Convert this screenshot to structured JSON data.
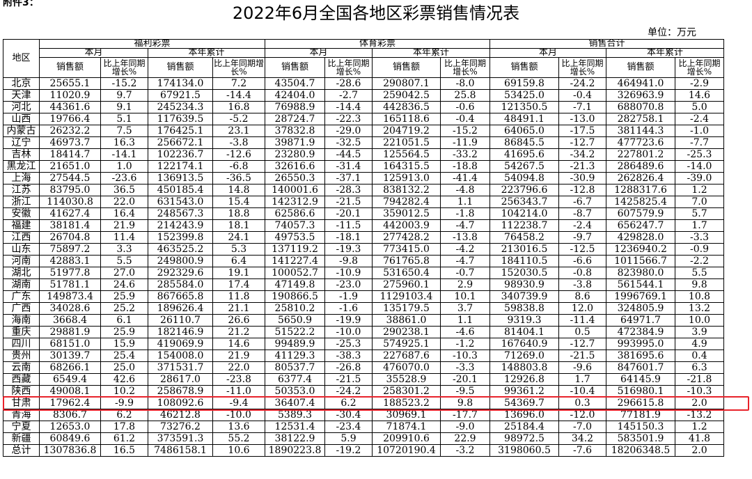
{
  "top_note": "附件3：",
  "title": "2022年6月全国各地区彩票销售情况表",
  "unit": "单位：万元",
  "headers": {
    "region": "地区",
    "groups": [
      "福利彩票",
      "体育彩票",
      "销售合计"
    ],
    "periods": [
      "本月",
      "本年累计"
    ],
    "sales": "销售额",
    "growth": "比上年同期增长%"
  },
  "rows": [
    {
      "region": "北京",
      "cells": [
        "25655.1",
        "-15.2",
        "174134.0",
        "7.2",
        "43504.7",
        "-28.6",
        "290807.1",
        "-8.0",
        "69159.8",
        "-24.2",
        "464941.0",
        "-2.9"
      ]
    },
    {
      "region": "天津",
      "cells": [
        "11020.9",
        "9.7",
        "67921.5",
        "-14.4",
        "42404.0",
        "-2.7",
        "259042.5",
        "25.8",
        "53425.0",
        "-0.4",
        "326963.9",
        "14.6"
      ]
    },
    {
      "region": "河北",
      "cells": [
        "44361.6",
        "9.1",
        "245234.3",
        "16.8",
        "76988.9",
        "-14.4",
        "442836.5",
        "-0.6",
        "121350.5",
        "-7.1",
        "688070.8",
        "5.0"
      ]
    },
    {
      "region": "山西",
      "cells": [
        "19766.4",
        "5.1",
        "117639.5",
        "-5.2",
        "28724.7",
        "-22.3",
        "165118.6",
        "-0.4",
        "48491.1",
        "-13.0",
        "282758.1",
        "-2.4"
      ]
    },
    {
      "region": "内蒙古",
      "cells": [
        "26232.2",
        "7.5",
        "176425.1",
        "23.1",
        "37832.8",
        "-29.0",
        "204719.2",
        "-15.2",
        "64065.0",
        "-17.5",
        "381144.3",
        "-1.0"
      ]
    },
    {
      "region": "辽宁",
      "cells": [
        "46973.7",
        "16.3",
        "256672.1",
        "-3.8",
        "39871.9",
        "-32.5",
        "221051.5",
        "-11.9",
        "86845.5",
        "-12.7",
        "477723.6",
        "-7.7"
      ]
    },
    {
      "region": "吉林",
      "cells": [
        "18414.7",
        "-14.1",
        "102236.7",
        "-12.6",
        "23280.9",
        "-44.5",
        "125564.5",
        "-33.2",
        "41695.6",
        "-34.2",
        "227801.2",
        "-25.3"
      ]
    },
    {
      "region": "黑龙江",
      "cells": [
        "21651.0",
        "1.0",
        "122174.1",
        "-6.8",
        "32616.6",
        "-31.4",
        "164315.5",
        "-18.8",
        "54267.5",
        "-21.3",
        "286489.6",
        "-14.0"
      ]
    },
    {
      "region": "上海",
      "cells": [
        "27544.5",
        "-23.6",
        "136913.5",
        "-36.5",
        "26550.3",
        "-37.1",
        "125913.0",
        "-41.4",
        "54094.8",
        "-30.9",
        "262826.4",
        "-39.0"
      ]
    },
    {
      "region": "江苏",
      "cells": [
        "83795.0",
        "36.5",
        "450185.4",
        "14.8",
        "140001.6",
        "-28.3",
        "838132.2",
        "-4.8",
        "223796.6",
        "-12.8",
        "1288317.6",
        "1.2"
      ]
    },
    {
      "region": "浙江",
      "cells": [
        "114030.8",
        "22.0",
        "631543.0",
        "15.4",
        "142312.9",
        "-21.5",
        "794282.4",
        "1.1",
        "256343.7",
        "-6.7",
        "1425825.4",
        "7.0"
      ]
    },
    {
      "region": "安徽",
      "cells": [
        "41627.4",
        "16.4",
        "248567.3",
        "18.8",
        "62586.6",
        "-20.1",
        "359012.5",
        "-1.8",
        "104214.0",
        "-8.7",
        "607579.9",
        "5.7"
      ]
    },
    {
      "region": "福建",
      "cells": [
        "38181.4",
        "21.9",
        "214243.9",
        "18.1",
        "74057.3",
        "-11.5",
        "442003.9",
        "-4.7",
        "112238.7",
        "-2.4",
        "656247.7",
        "1.7"
      ]
    },
    {
      "region": "江西",
      "cells": [
        "26704.8",
        "11.4",
        "152399.8",
        "24.1",
        "49753.5",
        "-18.1",
        "277428.2",
        "-13.8",
        "76458.2",
        "-9.7",
        "429828.0",
        "-3.3"
      ]
    },
    {
      "region": "山东",
      "cells": [
        "75897.2",
        "3.3",
        "463525.2",
        "5.3",
        "137119.2",
        "-19.3",
        "773415.0",
        "-4.2",
        "213016.5",
        "-12.5",
        "1236940.2",
        "-0.9"
      ]
    },
    {
      "region": "河南",
      "cells": [
        "42883.1",
        "5.5",
        "249800.9",
        "6.4",
        "141227.4",
        "-9.8",
        "761765.8",
        "-4.7",
        "184110.5",
        "-6.6",
        "1011566.7",
        "-2.2"
      ]
    },
    {
      "region": "湖北",
      "cells": [
        "51977.8",
        "27.0",
        "292329.6",
        "19.1",
        "100052.7",
        "-10.9",
        "531650.4",
        "-0.7",
        "152030.5",
        "-0.8",
        "823980.0",
        "5.5"
      ]
    },
    {
      "region": "湖南",
      "cells": [
        "51781.1",
        "24.6",
        "285584.0",
        "17.4",
        "47149.8",
        "-23.0",
        "275960.1",
        "2.9",
        "98930.9",
        "-3.8",
        "561544.1",
        "9.8"
      ]
    },
    {
      "region": "广东",
      "cells": [
        "149873.4",
        "25.9",
        "867665.8",
        "11.8",
        "190866.5",
        "-1.9",
        "1129103.4",
        "10.1",
        "340739.9",
        "8.6",
        "1996769.1",
        "10.8"
      ]
    },
    {
      "region": "广西",
      "cells": [
        "34028.6",
        "25.2",
        "189626.4",
        "21.1",
        "25810.2",
        "-1.6",
        "135179.5",
        "3.7",
        "59838.8",
        "12.0",
        "324805.9",
        "13.2"
      ]
    },
    {
      "region": "海南",
      "cells": [
        "3668.4",
        "6.1",
        "26110.7",
        "26.6",
        "5650.9",
        "-19.9",
        "38861.0",
        "1.1",
        "9319.3",
        "-11.4",
        "64971.7",
        "10.0"
      ]
    },
    {
      "region": "重庆",
      "cells": [
        "29881.9",
        "25.9",
        "182146.9",
        "21.2",
        "51522.2",
        "-10.0",
        "290238.1",
        "-4.6",
        "81404.1",
        "0.5",
        "472384.9",
        "3.9"
      ]
    },
    {
      "region": "四川",
      "cells": [
        "68151.0",
        "15.9",
        "419069.9",
        "14.6",
        "99489.9",
        "-25.3",
        "574925.1",
        "-1.2",
        "167640.9",
        "-12.7",
        "993995.0",
        "4.9"
      ]
    },
    {
      "region": "贵州",
      "cells": [
        "30139.7",
        "25.4",
        "154008.0",
        "21.9",
        "41129.3",
        "-38.3",
        "227687.6",
        "-10.3",
        "71269.0",
        "-21.5",
        "381695.6",
        "0.4"
      ]
    },
    {
      "region": "云南",
      "cells": [
        "68266.1",
        "25.0",
        "371531.7",
        "22.0",
        "80537.7",
        "-26.8",
        "476070.0",
        "-3.3",
        "148803.8",
        "-9.6",
        "847601.7",
        "6.3"
      ]
    },
    {
      "region": "西藏",
      "cells": [
        "6549.4",
        "42.6",
        "28617.0",
        "-23.8",
        "6377.4",
        "-21.5",
        "35528.9",
        "-20.1",
        "12926.8",
        "1.7",
        "64145.9",
        "-21.8"
      ]
    },
    {
      "region": "陕西",
      "cells": [
        "49008.1",
        "10.2",
        "258678.9",
        "-11.0",
        "50353.0",
        "-24.2",
        "258301.2",
        "-9.5",
        "99361.2",
        "-10.4",
        "516980.1",
        "-10.3"
      ]
    },
    {
      "region": "甘肃",
      "cells": [
        "17962.4",
        "-9.9",
        "108092.6",
        "-9.4",
        "36407.4",
        "6.2",
        "188523.2",
        "9.8",
        "54369.7",
        "0.3",
        "296615.8",
        "2.0"
      ],
      "highlight": true
    },
    {
      "region": "青海",
      "cells": [
        "8306.7",
        "6.2",
        "46212.8",
        "-10.0",
        "5389.3",
        "-30.4",
        "30969.1",
        "-17.7",
        "13696.0",
        "-12.0",
        "77181.9",
        "-13.2"
      ]
    },
    {
      "region": "宁夏",
      "cells": [
        "12653.0",
        "17.8",
        "73276.2",
        "13.6",
        "12531.4",
        "-23.4",
        "71874.1",
        "-9.0",
        "25184.4",
        "-7.0",
        "145150.3",
        "1.2"
      ]
    },
    {
      "region": "新疆",
      "cells": [
        "60849.6",
        "61.2",
        "373591.3",
        "55.2",
        "38122.9",
        "5.9",
        "209910.6",
        "22.9",
        "98972.5",
        "34.2",
        "583501.9",
        "41.8"
      ]
    },
    {
      "region": "总计",
      "cells": [
        "1307836.8",
        "16.5",
        "7486158.1",
        "10.6",
        "1890223.8",
        "-19.2",
        "10720190.4",
        "-3.2",
        "3198060.5",
        "-7.6",
        "18206348.5",
        "2.0"
      ]
    }
  ],
  "colors": {
    "highlight_border": "#e8222a",
    "grid": "#000000"
  }
}
